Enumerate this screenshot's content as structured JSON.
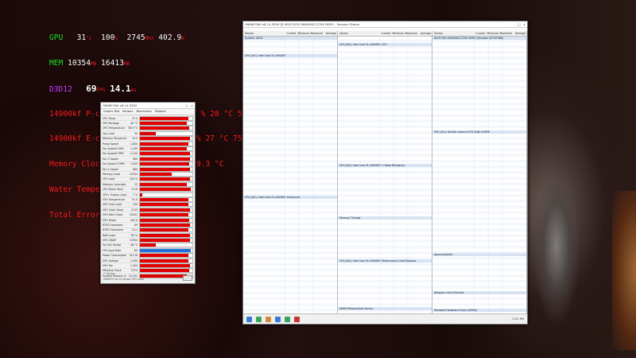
{
  "osd": {
    "gpu_label": "GPU",
    "gpu_temp": "31",
    "gpu_temp_unit": "°C",
    "gpu_load": "100",
    "gpu_load_unit": "%",
    "gpu_clock": "2745",
    "gpu_clock_unit": "MHz",
    "gpu_power": "402.9",
    "gpu_power_unit": "W",
    "mem_label": "MEM",
    "mem_used": "10354",
    "mem_used_unit": "MB",
    "mem_total": "16413",
    "mem_total_unit": "MB",
    "api_label": "D3D12",
    "fps": "69",
    "fps_unit": "FPS",
    "frametime": "14.1",
    "frametime_unit": "ms",
    "line_pcore": "14900kf P-core: 6,300.0 MHz 34.3 % 28 °C 53 A",
    "line_ecore": "14900kf E-core: 4,800.0 MHz 0.1 % 27 °C 75 W",
    "line_memclock": "Memory Clock: 8,400.0 MHz 36 T 19.3 °C",
    "line_water": "Water Temperature: 18.6 °C",
    "line_errors": "Total Errors: 0"
  },
  "mini_window": {
    "title": "HWiNFO64 v8.14-5550",
    "tabs": [
      "Graphs Text",
      "Sensors",
      "Benchmark",
      "Toolbars"
    ],
    "footer_check": "Sensor",
    "footer_text": "HWiNFO v8.14 sensor GPU state",
    "rows": [
      {
        "name": "CPU Temp",
        "value": "37.5",
        "level": 0.92,
        "color": "red"
      },
      {
        "name": "CPU Package",
        "value": "40 °C",
        "level": 0.9,
        "color": "red"
      },
      {
        "name": "CPU Temperature",
        "value": "36.5 °C",
        "level": 0.94,
        "color": "red"
      },
      {
        "name": "Cpu Load",
        "value": "34",
        "level": 0.3,
        "color": "red"
      },
      {
        "name": "Memory Temperature",
        "value": "19.3",
        "level": 0.95,
        "color": "red"
      },
      {
        "name": "Pump Speed",
        "value": "1,800",
        "level": 0.93,
        "color": "red"
      },
      {
        "name": "Fan Speed1 RPM",
        "value": "1,200",
        "level": 0.9,
        "color": "red"
      },
      {
        "name": "Fan Speed2 RPM",
        "value": "1,100",
        "level": 0.96,
        "color": "red"
      },
      {
        "name": "Fan 3 Speed",
        "value": "980",
        "level": 0.95,
        "color": "red"
      },
      {
        "name": "Fan Speed 4 RPM",
        "value": "1,050",
        "level": 0.94,
        "color": "red"
      },
      {
        "name": "Fan 4 Speed",
        "value": "880",
        "level": 0.96,
        "color": "red"
      },
      {
        "name": "Memory Used",
        "value": "10354",
        "level": 0.6,
        "color": "red"
      },
      {
        "name": "CPU Load",
        "value": "100 %",
        "level": 0.95,
        "color": "red"
      },
      {
        "name": "Memory Controller",
        "value": "12",
        "level": 0.9,
        "color": "red"
      },
      {
        "name": "CPU Power Total",
        "value": "75 W",
        "level": 0.97,
        "color": "red"
      },
      {
        "name": "CPU+ Engine Load",
        "value": "7 %",
        "level": 0.05,
        "color": "red"
      },
      {
        "name": "GPU Temperature",
        "value": "31.0",
        "level": 0.92,
        "color": "red"
      },
      {
        "name": "GPU Core Load",
        "value": "100",
        "level": 0.93,
        "color": "red"
      },
      {
        "name": "GPU Clock Temp",
        "value": "2745",
        "level": 0.96,
        "color": "red"
      },
      {
        "name": "GPU Mem Clock",
        "value": "10501",
        "level": 0.92,
        "color": "red"
      },
      {
        "name": "GPU Power",
        "value": "402.9",
        "level": 0.94,
        "color": "red"
      },
      {
        "name": "RTSS Framerate",
        "value": "69",
        "level": 0.95,
        "color": "red"
      },
      {
        "name": "RTSS Frametime",
        "value": "14.1",
        "level": 0.93,
        "color": "red"
      },
      {
        "name": "RAM Load",
        "value": "63 %",
        "level": 0.96,
        "color": "red"
      },
      {
        "name": "GPU VRAM",
        "value": "10354",
        "level": 0.95,
        "color": "red"
      },
      {
        "name": "Fan Ext Sensor",
        "value": "48 °C",
        "level": 0.3,
        "color": "red"
      },
      {
        "name": "FPS Input Rate",
        "value": "60",
        "level": 0.97,
        "color": "blue"
      },
      {
        "name": "Power Consumption",
        "value": "412 W",
        "level": 0.92,
        "color": "red"
      },
      {
        "name": "GPU Voltage",
        "value": "1.050",
        "level": 0.93,
        "color": "red"
      },
      {
        "name": "GPU Fan",
        "value": "1,450",
        "level": 0.95,
        "color": "red"
      },
      {
        "name": "Effective Clock",
        "value": "2712",
        "level": 0.94,
        "color": "red"
      },
      {
        "name": "System Memory Used",
        "value": "20,331",
        "level": 0.9,
        "color": "red"
      }
    ]
  },
  "main_window": {
    "title": "HWiNFO64 v8.14-5550 @ ASUS ROG MAXIMUS Z790 HERO - Sensors Status",
    "columns": [
      "Sensor",
      "Current",
      "Minimum",
      "Maximum",
      "Average"
    ],
    "col1_sections": [
      "System: ASUS",
      "CPU [#0]: Intel Core i9-14900KF",
      "CPU [#0]: Intel Core i9-14900KF: Enhanced"
    ],
    "col2_sections": [
      "CPU [#0]: Intel Core i9-14900KF: DTS",
      "CPU [#0]: Intel Core i9-14900KF: C-State Residency",
      "Memory Timings",
      "CPU [#0]: Intel Core i9-14900KF: Performance Limit Reasons",
      "DIMM Temperature Sensor"
    ],
    "col3_sections": [
      "ASUS ROG MAXIMUS Z790 HERO (Nuvoton NCT6798D)",
      "GPU [#0]: NVIDIA GeForce RTX 4080 SUPER",
      "Aquacomputer",
      "Network: Intel Ethernet",
      "Windows Hardware Errors (WHEA)"
    ],
    "clock": "2:31 PM"
  }
}
